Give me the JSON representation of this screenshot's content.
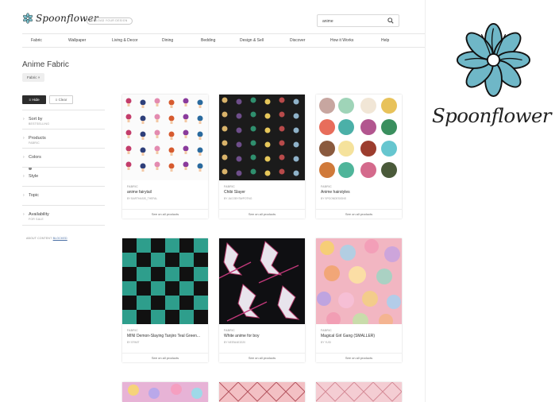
{
  "header": {
    "logo_text": "Spoonflower",
    "upload_label": "UPLOAD YOUR DESIGN",
    "search": {
      "value": "anime",
      "placeholder": ""
    }
  },
  "nav": {
    "items": [
      "Fabric",
      "Wallpaper",
      "Living & Decor",
      "Dining",
      "Bedding",
      "Design & Sell",
      "Discover",
      "How it Works",
      "Help"
    ]
  },
  "page": {
    "title": "Anime Fabric",
    "active_filter": "Fabric ×"
  },
  "filters": {
    "hide_label": "Hide",
    "clear_label": "Clear",
    "rows": [
      {
        "title": "Sort by",
        "sub": "BESTSELLING"
      },
      {
        "title": "Products",
        "sub": "FABRIC"
      },
      {
        "title": "Colors",
        "sub": ""
      },
      {
        "title": "Style",
        "sub": ""
      },
      {
        "title": "Topic",
        "sub": ""
      },
      {
        "title": "Availability",
        "sub": "FOR SALE"
      }
    ],
    "about_text": "ABOUT CONTENT",
    "about_link": "BLOCKED"
  },
  "products": [
    {
      "type": "FABRIC",
      "title": "anime fairytail",
      "by": "BY BARTHASIS_THEFAL",
      "link": "See on all products"
    },
    {
      "type": "FABRIC",
      "title": "Chibi Slayer",
      "by": "BY JACOBYSWPOTNG",
      "link": "See on all products"
    },
    {
      "type": "FABRIC",
      "title": "Anime hairstyles",
      "by": "BY SPOONDESIGNS",
      "link": "See on all products"
    },
    {
      "type": "FABRIC",
      "title": "MINI Demon-Slaying Tanjiro Teal Green...",
      "by": "BY ERMIT",
      "link": "See on all products"
    },
    {
      "type": "FABRIC",
      "title": "White anime for boy",
      "by": "BY NEENIAE2020",
      "link": "See on all products"
    },
    {
      "type": "FABRIC",
      "title": "Magical Girl Gang (SMALLER)",
      "by": "BY YUSI",
      "link": "See on all products"
    }
  ],
  "brand": {
    "text": "Spoonflower",
    "color": "#6fb7c7"
  },
  "colors": {
    "teal": "#2e9e8c",
    "black": "#111111",
    "pink": "#f2a7b5"
  }
}
